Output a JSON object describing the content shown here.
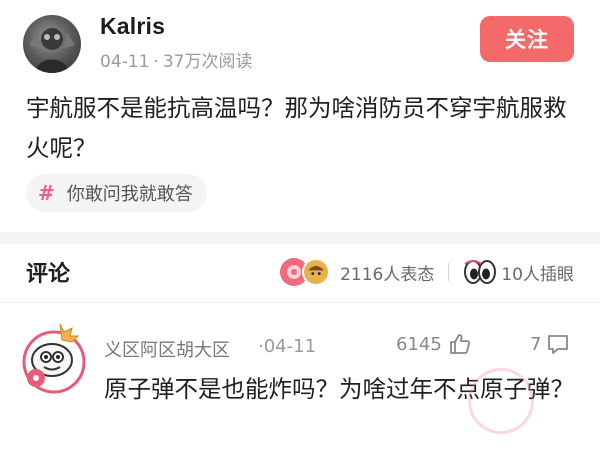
{
  "post": {
    "author": "Kalris",
    "date": "04-11",
    "meta_separator": "·",
    "views": "37万次阅读",
    "follow_label": "关注",
    "text": "宇航服不是能抗高温吗？那为啥消防员不穿宇航服救火呢？",
    "topic": {
      "icon": "hashtag-icon",
      "symbol": "#",
      "label": "你敢问我就敢答"
    }
  },
  "comments_header": {
    "title": "评论",
    "reactions_label": "2116人表态",
    "bookmarks_label": "10人插眼"
  },
  "comments": [
    {
      "author": "义区阿区胡大区",
      "date": "04-11",
      "likes": "6145",
      "replies": "7",
      "text": "原子弹不是也能炸吗？为啥过年不点原子弹？"
    }
  ],
  "colors": {
    "follow_button": "#f46a6a",
    "hashtag": "#ef5f7a",
    "secondary_text": "#9a9a9a"
  }
}
